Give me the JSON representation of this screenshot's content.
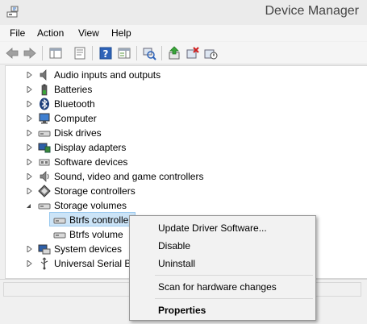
{
  "window": {
    "title": "Device Manager"
  },
  "menu": [
    "File",
    "Action",
    "View",
    "Help"
  ],
  "toolbar": {
    "buttons": [
      "back-icon",
      "forward-icon",
      "show-hide-console-tree-icon",
      "properties-icon",
      "help-icon",
      "action-pane-icon",
      "scan-hardware-icon",
      "update-driver-icon",
      "uninstall-device-icon",
      "disable-device-icon"
    ]
  },
  "tree": {
    "items": [
      {
        "label": "Audio inputs and outputs",
        "icon": "speaker-icon",
        "expanded": false
      },
      {
        "label": "Batteries",
        "icon": "battery-icon",
        "expanded": false
      },
      {
        "label": "Bluetooth",
        "icon": "bluetooth-icon",
        "expanded": false
      },
      {
        "label": "Computer",
        "icon": "computer-icon",
        "expanded": false
      },
      {
        "label": "Disk drives",
        "icon": "disk-drive-icon",
        "expanded": false
      },
      {
        "label": "Display adapters",
        "icon": "display-adapter-icon",
        "expanded": false
      },
      {
        "label": "Software devices",
        "icon": "software-device-icon",
        "expanded": false
      },
      {
        "label": "Sound, video and game controllers",
        "icon": "sound-controller-icon",
        "expanded": false
      },
      {
        "label": "Storage controllers",
        "icon": "storage-controller-icon",
        "expanded": false
      },
      {
        "label": "Storage volumes",
        "icon": "storage-volume-icon",
        "expanded": true
      },
      {
        "label": "Btrfs controller",
        "icon": "volume-icon",
        "child": true,
        "selected": true
      },
      {
        "label": "Btrfs volume",
        "icon": "volume-icon",
        "child": true
      },
      {
        "label": "System devices",
        "icon": "system-device-icon",
        "expanded": false
      },
      {
        "label": "Universal Serial Bu",
        "icon": "usb-icon",
        "expanded": false
      }
    ]
  },
  "context_menu": {
    "update_driver": "Update Driver Software...",
    "disable": "Disable",
    "uninstall": "Uninstall",
    "scan": "Scan for hardware changes",
    "properties": "Properties"
  },
  "colors": {
    "selection": "#cce4f7",
    "selection_border": "#99c9ef",
    "menu_bg": "#f2f2f2"
  }
}
